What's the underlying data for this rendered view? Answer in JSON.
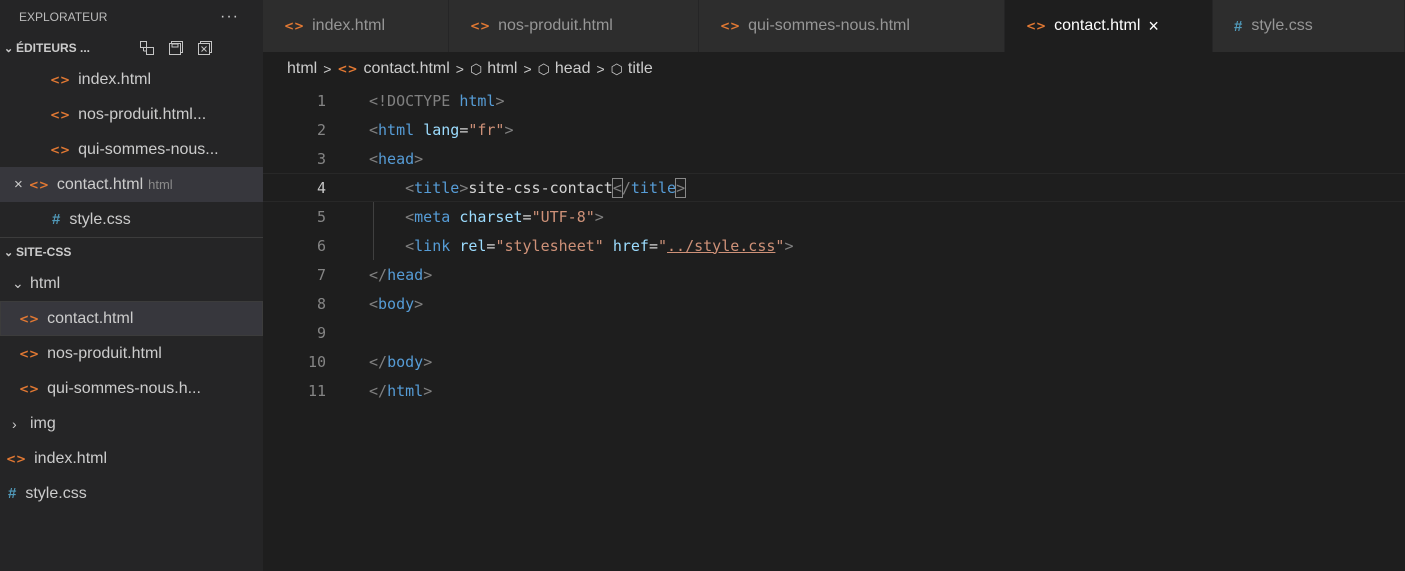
{
  "sidebar": {
    "title": "EXPLORATEUR",
    "more": "···",
    "open_editors": {
      "label": "ÉDITEURS ...",
      "items": [
        {
          "name": "index.html",
          "icon": "html-icon"
        },
        {
          "name": "nos-produit.html...",
          "icon": "html-icon"
        },
        {
          "name": "qui-sommes-nous...",
          "icon": "html-icon"
        },
        {
          "name": "contact.html",
          "desc": "html",
          "icon": "html-icon",
          "close": "×"
        },
        {
          "name": "style.css",
          "icon": "css-icon"
        }
      ]
    },
    "project": {
      "label": "SITE-CSS",
      "folder_html": "html",
      "html_files": [
        "contact.html",
        "nos-produit.html",
        "qui-sommes-nous.h..."
      ],
      "folder_img": "img",
      "root_files": [
        "index.html",
        "style.css"
      ]
    }
  },
  "tabs": [
    {
      "label": "index.html",
      "icon": "html-icon"
    },
    {
      "label": "nos-produit.html",
      "icon": "html-icon"
    },
    {
      "label": "qui-sommes-nous.html",
      "icon": "html-icon"
    },
    {
      "label": "contact.html",
      "icon": "html-icon",
      "active": true,
      "close": "×"
    },
    {
      "label": "style.css",
      "icon": "css-icon"
    }
  ],
  "breadcrumb": [
    "html",
    "contact.html",
    "html",
    "head",
    "title"
  ],
  "editor": {
    "line_numbers": [
      "1",
      "2",
      "3",
      "4",
      "5",
      "6",
      "7",
      "8",
      "9",
      "10",
      "11"
    ],
    "current_line": 4
  },
  "colors": {
    "html_icon": "#e37933",
    "css_icon": "#519aba",
    "tag": "#569cd6",
    "attribute": "#9cdcfe",
    "string": "#ce9178"
  }
}
